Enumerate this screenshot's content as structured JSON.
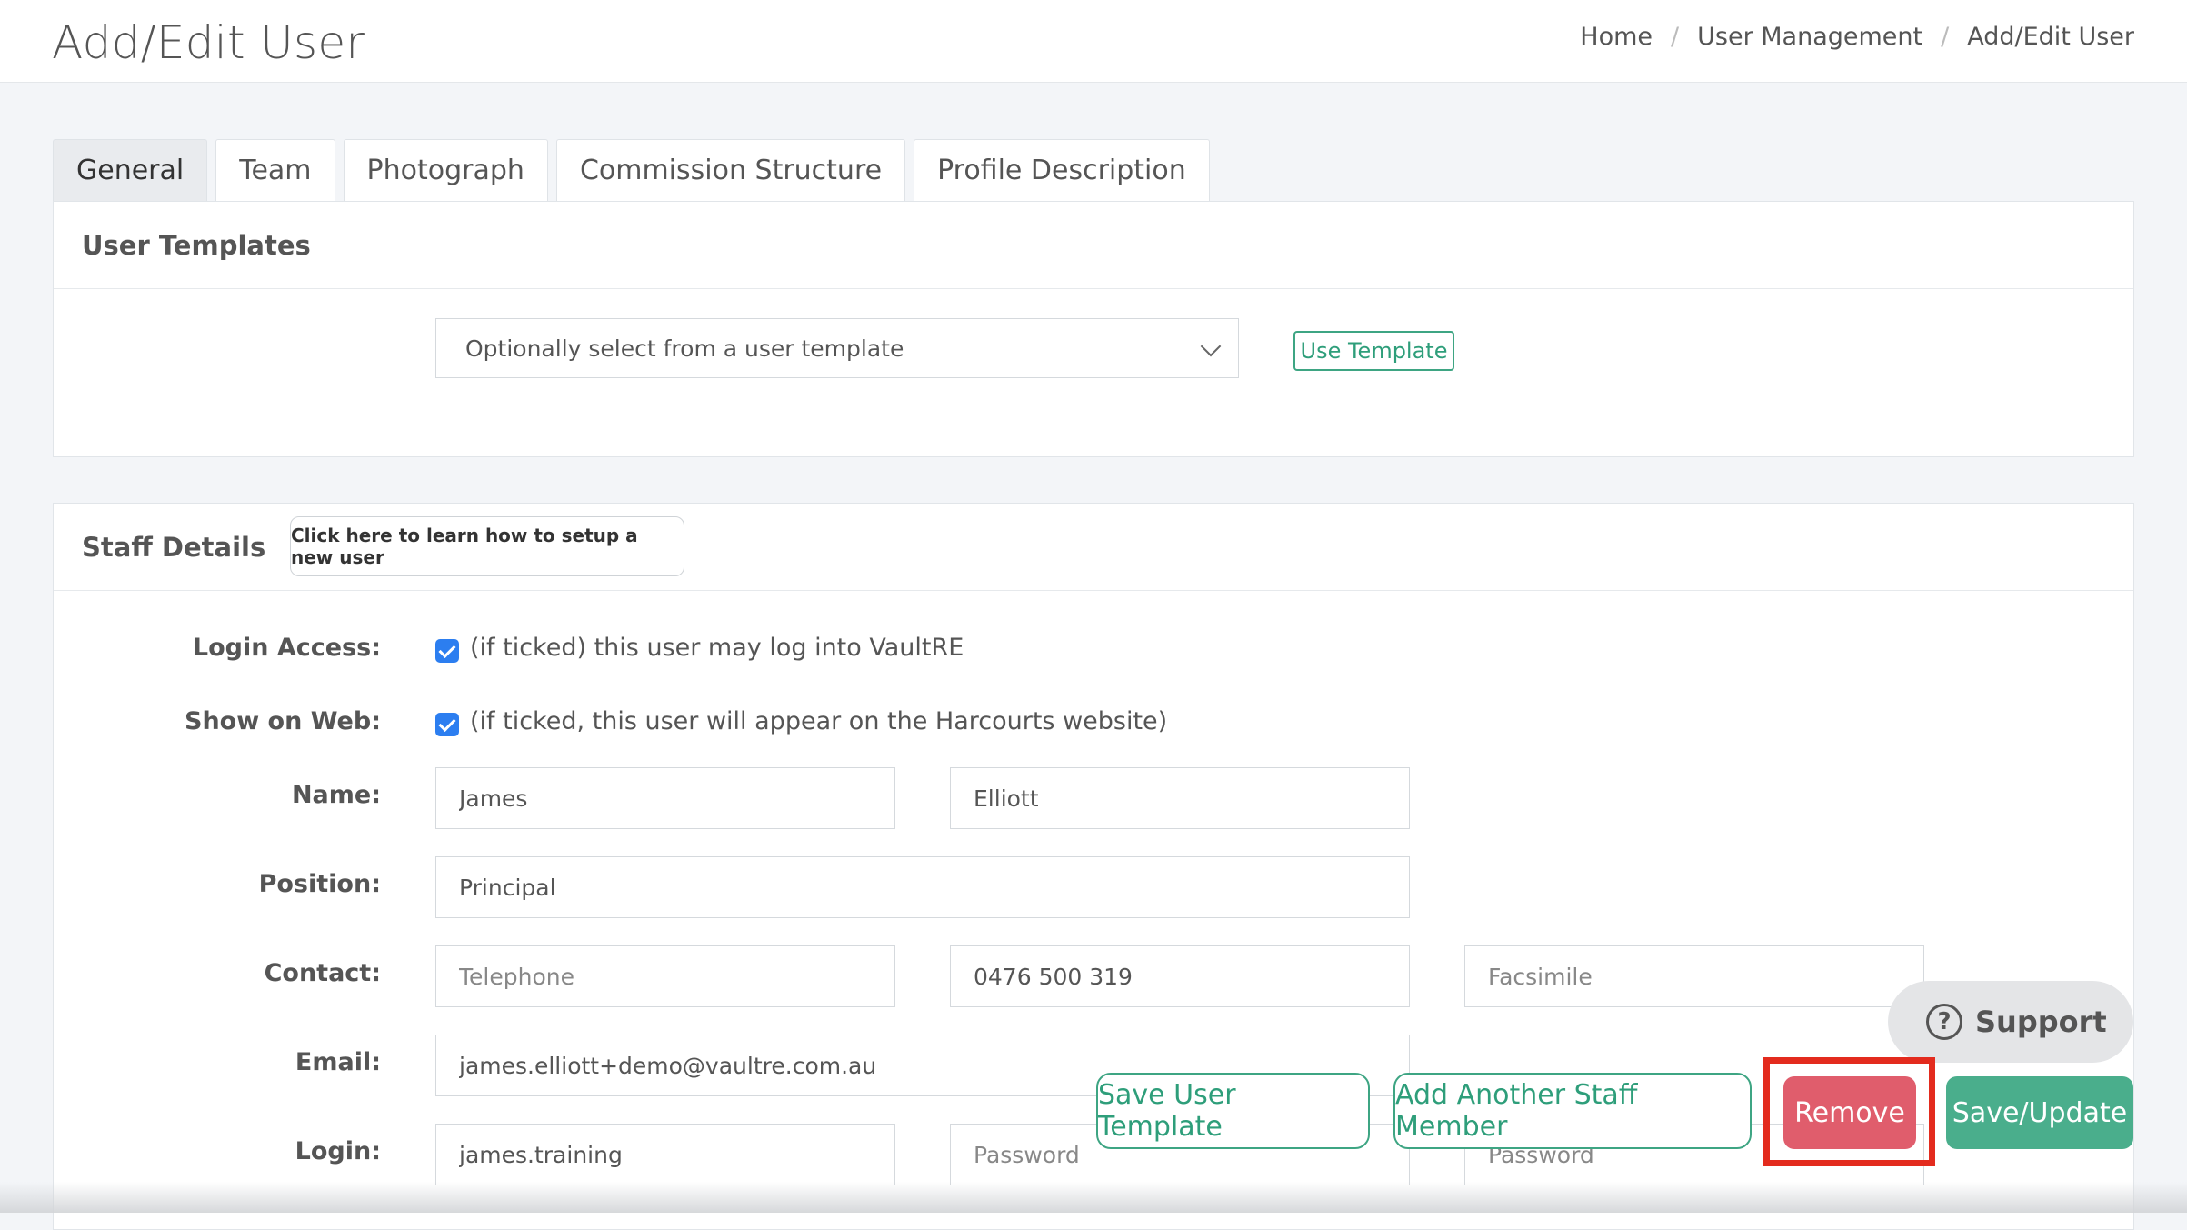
{
  "header": {
    "title": "Add/Edit User",
    "breadcrumb": [
      "Home",
      "User Management",
      "Add/Edit User"
    ],
    "separator": "/"
  },
  "tabs": [
    {
      "label": "General",
      "active": true
    },
    {
      "label": "Team",
      "active": false
    },
    {
      "label": "Photograph",
      "active": false
    },
    {
      "label": "Commission Structure",
      "active": false
    },
    {
      "label": "Profile Description",
      "active": false
    }
  ],
  "user_templates": {
    "title": "User Templates",
    "select_value": "Optionally select from a user template",
    "use_template_label": "Use Template"
  },
  "staff_details": {
    "title": "Staff Details",
    "help_label": "Click here to learn how to setup a new user",
    "login_access": {
      "label": "Login Access:",
      "checked": true,
      "text": "(if ticked) this user may log into VaultRE"
    },
    "show_on_web": {
      "label": "Show on Web:",
      "checked": true,
      "text": "(if ticked, this user will appear on the Harcourts website)"
    },
    "name": {
      "label": "Name:",
      "first": "James",
      "last": "Elliott"
    },
    "position": {
      "label": "Position:",
      "value": "Principal"
    },
    "contact": {
      "label": "Contact:",
      "telephone_placeholder": "Telephone",
      "mobile": "0476 500 319",
      "facsimile_placeholder": "Facsimile"
    },
    "email": {
      "label": "Email:",
      "value": "james.elliott+demo@vaultre.com.au"
    },
    "login": {
      "label": "Login:",
      "value": "james.training",
      "password_placeholder": "Password",
      "confirm_placeholder": "Password"
    }
  },
  "actions": {
    "save_template": "Save User Template",
    "add_staff": "Add Another Staff Member",
    "remove": "Remove",
    "save_update": "Save/Update"
  },
  "support": {
    "label": "Support",
    "icon_glyph": "?"
  },
  "colors": {
    "accent": "#3ea583",
    "danger": "#e05d6c",
    "highlight": "#e32b1e",
    "checkbox": "#2c7ef0"
  }
}
